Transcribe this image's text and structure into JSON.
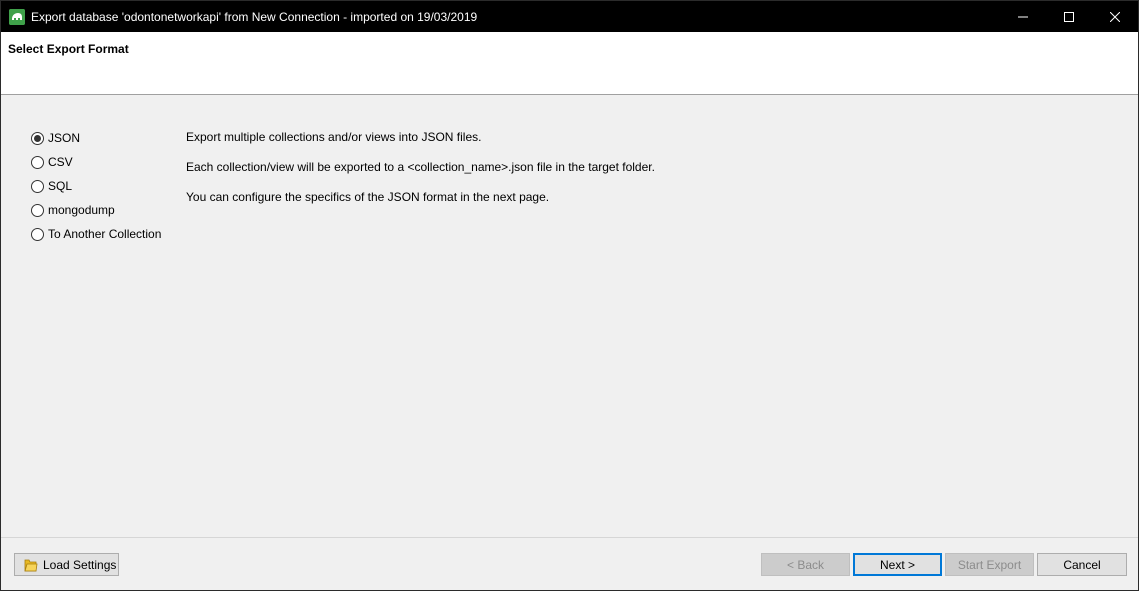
{
  "window": {
    "title": "Export database 'odontonetworkapi' from New Connection - imported on 19/03/2019",
    "icon": "app-icon",
    "controls": [
      "minimize-icon",
      "maximize-icon",
      "close-icon"
    ]
  },
  "header": {
    "title": "Select Export Format"
  },
  "formats": [
    {
      "label": "JSON",
      "checked": true
    },
    {
      "label": "CSV",
      "checked": false
    },
    {
      "label": "SQL",
      "checked": false
    },
    {
      "label": "mongodump",
      "checked": false
    },
    {
      "label": "To Another Collection",
      "checked": false
    }
  ],
  "description": {
    "line1": "Export multiple collections and/or views into JSON files.",
    "line2": "Each collection/view will be exported to a <collection_name>.json file in the target folder.",
    "line3": "You can configure the specifics of the JSON format in the next page."
  },
  "footer": {
    "load_settings_label": "Load Settings",
    "load_settings_icon": "folder-icon",
    "back_label": "< Back",
    "next_label": "Next >",
    "start_export_label": "Start Export",
    "cancel_label": "Cancel"
  },
  "colors": {
    "titlebar": "#000000",
    "accent": "#0078d7",
    "background": "#f0f0f0"
  }
}
